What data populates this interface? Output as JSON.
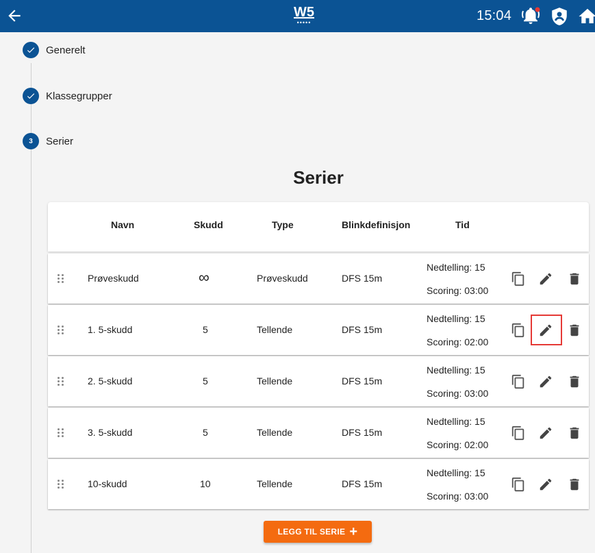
{
  "header": {
    "logo_text": "W5",
    "time": "15:04",
    "colors": {
      "bar": "#0b5394",
      "notification_dot": "#e53935"
    }
  },
  "steps": [
    {
      "label": "Generelt",
      "state": "completed"
    },
    {
      "label": "Klassegrupper",
      "state": "completed"
    },
    {
      "label": "Serier",
      "state": "active",
      "number": "3"
    }
  ],
  "page_title": "Serier",
  "table": {
    "columns": [
      "Navn",
      "Skudd",
      "Type",
      "Blinkdefinisjon",
      "Tid"
    ],
    "rows": [
      {
        "navn": "Prøveskudd",
        "skudd": "∞",
        "type": "Prøveskudd",
        "blink": "DFS 15m",
        "nedtelling": "Nedtelling: 15",
        "scoring": "Scoring: 03:00"
      },
      {
        "navn": "1. 5-skudd",
        "skudd": "5",
        "type": "Tellende",
        "blink": "DFS 15m",
        "nedtelling": "Nedtelling: 15",
        "scoring": "Scoring: 02:00"
      },
      {
        "navn": "2. 5-skudd",
        "skudd": "5",
        "type": "Tellende",
        "blink": "DFS 15m",
        "nedtelling": "Nedtelling: 15",
        "scoring": "Scoring: 03:00"
      },
      {
        "navn": "3. 5-skudd",
        "skudd": "5",
        "type": "Tellende",
        "blink": "DFS 15m",
        "nedtelling": "Nedtelling: 15",
        "scoring": "Scoring: 02:00"
      },
      {
        "navn": "10-skudd",
        "skudd": "10",
        "type": "Tellende",
        "blink": "DFS 15m",
        "nedtelling": "Nedtelling: 15",
        "scoring": "Scoring: 03:00"
      }
    ],
    "highlighted_action": "edit-icon on row 2"
  },
  "add_button": {
    "label": "LEGG TIL SERIE",
    "color": "#f46b10"
  }
}
